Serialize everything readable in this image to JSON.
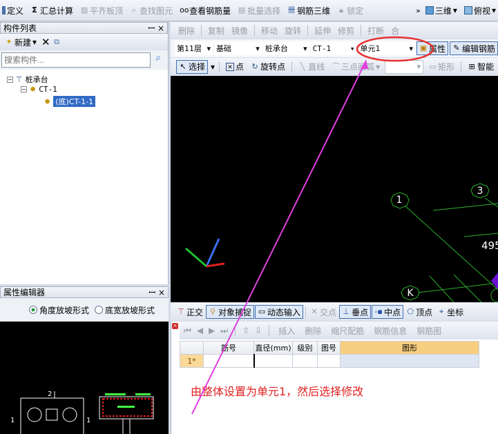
{
  "main_toolbar": [
    {
      "icon": "define-icon",
      "label": "定义",
      "enabled": true
    },
    {
      "icon": "sigma-icon",
      "label": "汇总计算",
      "enabled": true
    },
    {
      "icon": "align-slab-icon",
      "label": "平齐板顶",
      "enabled": false
    },
    {
      "icon": "binoculars-icon",
      "label": "查找图元",
      "enabled": false
    },
    {
      "icon": "glasses-icon",
      "label": "查看钢筋量",
      "enabled": true
    },
    {
      "icon": "batch-select-icon",
      "label": "批量选择",
      "enabled": false
    },
    {
      "icon": "rebar-3d-icon",
      "label": "钢筋三维",
      "enabled": true
    },
    {
      "icon": "lock-icon",
      "label": "锁定",
      "enabled": false
    }
  ],
  "view_buttons": {
    "overflow": "»",
    "view3d": "三维",
    "top_view": "俯视"
  },
  "component_list": {
    "title": "构件列表",
    "new_label": "新建",
    "search_placeholder": "搜索构件...",
    "tree": {
      "root": "桩承台",
      "child": "CT-1",
      "leaf": "(底)CT-1-1"
    }
  },
  "property_editor": {
    "title": "属性编辑器",
    "radio_angle": "角度放坡形式",
    "radio_width": "底宽放坡形式",
    "selected": "角度放坡形式"
  },
  "preview": {
    "label_top": "2",
    "label_left": "1",
    "label_right": "1"
  },
  "edit_toolbar": [
    "删除",
    "复制",
    "镜像",
    "移动",
    "旋转",
    "延伸",
    "修剪",
    "打断",
    "合"
  ],
  "selectors": {
    "floor": "第11层",
    "category": "基础",
    "type": "桩承台",
    "component": "CT-1",
    "unit": "单元1",
    "property_btn": "属性",
    "edit_rebar_btn": "编辑钢筋"
  },
  "draw_toolbar": {
    "select": "选择",
    "point": "点",
    "rotate_point": "旋转点",
    "line": "直线",
    "arc": "三点画弧",
    "rect": "矩形",
    "smart": "智能"
  },
  "canvas": {
    "axis_labels": [
      "1",
      "3",
      "K"
    ],
    "dimension": "495"
  },
  "snap_toolbar": {
    "ortho": "正交",
    "object_snap": "对象捕捉",
    "dynamic_input": "动态输入",
    "intersection": "交点",
    "perpendicular": "垂点",
    "midpoint": "中点",
    "vertex": "顶点",
    "coordinate": "坐标"
  },
  "grid_toolbar": {
    "insert": "插入",
    "delete": "删除",
    "scale_rebar": "缩尺配筋",
    "rebar_info": "钢筋信息",
    "rebar_graph": "钢筋图"
  },
  "rebar_table": {
    "headers": [
      "",
      "筋号",
      "直径(mm)",
      "级别",
      "图号",
      "图形"
    ],
    "rows": [
      [
        "1*",
        "",
        "",
        "",
        "",
        ""
      ]
    ]
  },
  "annotation": {
    "text": "由整体设置为单元1，然后选择修改",
    "color": "#e02020",
    "arrow_color": "#e040e0"
  }
}
